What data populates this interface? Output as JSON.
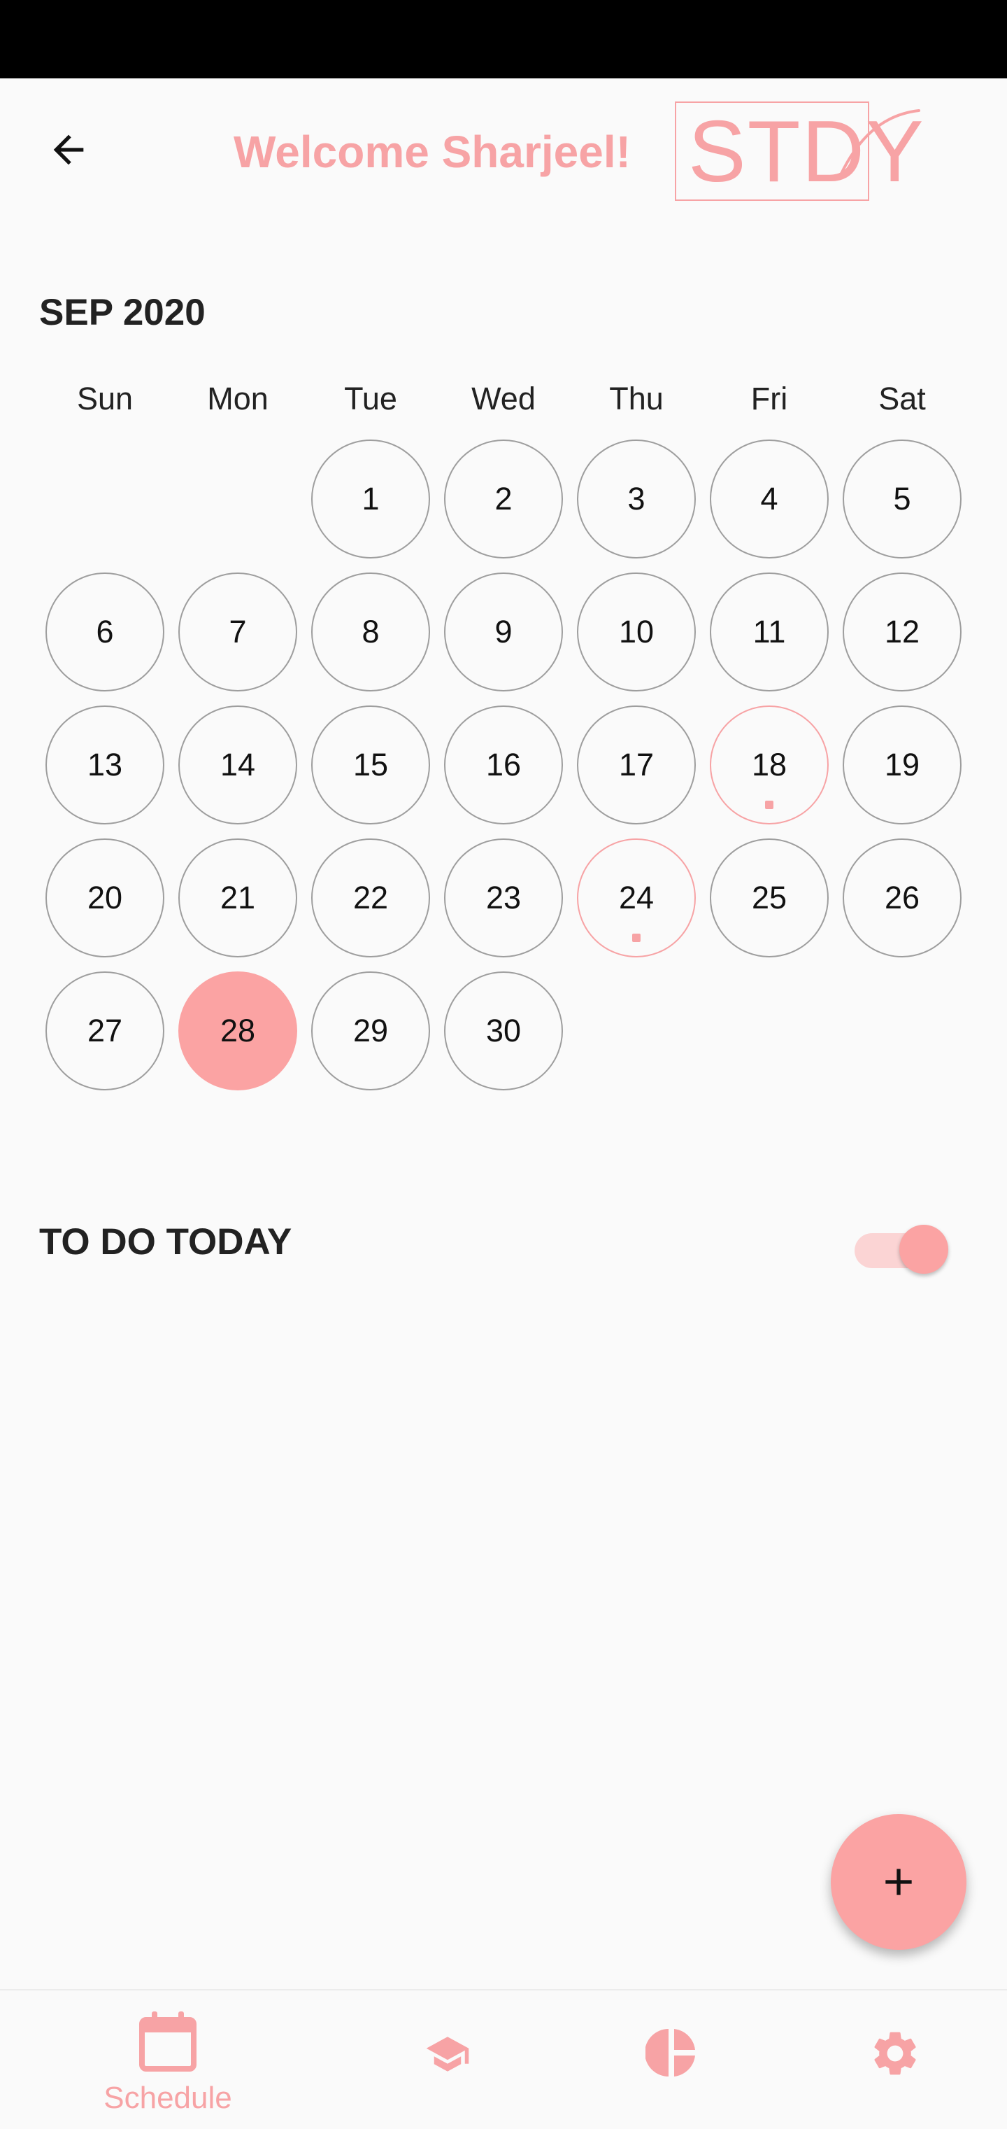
{
  "header": {
    "welcome_text": "Welcome Sharjeel!",
    "logo_text": "STDY"
  },
  "calendar": {
    "month_label": "SEP 2020",
    "weekdays": [
      "Sun",
      "Mon",
      "Tue",
      "Wed",
      "Thu",
      "Fri",
      "Sat"
    ],
    "days": [
      "1",
      "2",
      "3",
      "4",
      "5",
      "6",
      "7",
      "8",
      "9",
      "10",
      "11",
      "12",
      "13",
      "14",
      "15",
      "16",
      "17",
      "18",
      "19",
      "20",
      "21",
      "22",
      "23",
      "24",
      "25",
      "26",
      "27",
      "28",
      "29",
      "30"
    ],
    "selected_day": "28",
    "days_with_events": [
      "18",
      "24"
    ]
  },
  "todo": {
    "title": "TO DO TODAY",
    "toggle_on": true
  },
  "bottom_nav": {
    "items": [
      {
        "label": "Schedule",
        "icon": "calendar-icon",
        "active": true
      },
      {
        "label": "",
        "icon": "graduation-cap-icon",
        "active": false
      },
      {
        "label": "",
        "icon": "pie-chart-icon",
        "active": false
      },
      {
        "label": "",
        "icon": "gear-icon",
        "active": false
      }
    ]
  },
  "colors": {
    "accent": "#fba3a3",
    "accent_text": "#f7a3a5",
    "border": "#9e9e9e",
    "background": "#fafafa"
  }
}
